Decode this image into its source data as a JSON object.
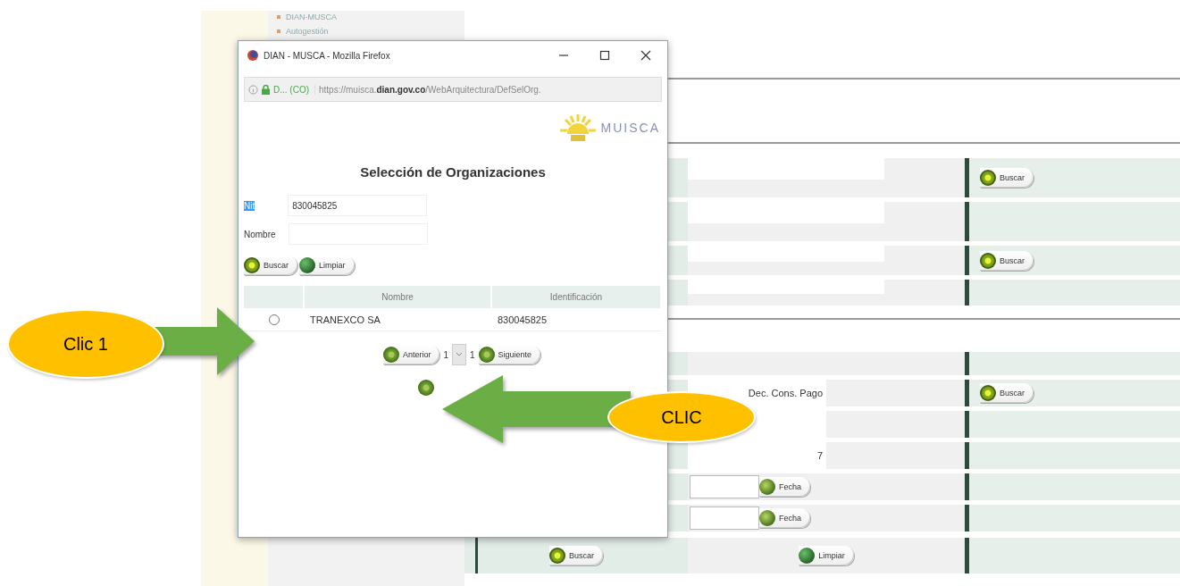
{
  "sidebar": {
    "items": [
      {
        "label": "DIAN-MUSCA"
      },
      {
        "label": "Autogestión"
      }
    ]
  },
  "form": {
    "sections": [
      {
        "rows": [
          {
            "kind": "input",
            "action": "Buscar"
          },
          {
            "kind": "input"
          },
          {
            "kind": "input",
            "action": "Buscar"
          },
          {
            "kind": "input"
          }
        ]
      },
      {
        "rows": [
          {
            "kind": "plain"
          },
          {
            "kind": "text",
            "text": "Dec. Cons. Pago",
            "action": "Buscar"
          },
          {
            "kind": "blank"
          },
          {
            "kind": "text",
            "text": "7"
          },
          {
            "kind": "date",
            "button": "Fecha"
          },
          {
            "kind": "date",
            "button": "Fecha"
          }
        ],
        "footer": [
          {
            "label": "Buscar"
          },
          {
            "label": "Limpiar"
          }
        ]
      }
    ]
  },
  "popup": {
    "title": "DIAN - MUSCA - Mozilla Firefox",
    "site": "D... (CO)",
    "url": "https://muisca.**dian.gov.co**/WebArquitectura/DefSelOrg.",
    "logo": "MUISCA",
    "heading": "Selección de Organizaciones",
    "fields": [
      {
        "label": "Nit",
        "value": "830045825",
        "highlighted": true
      },
      {
        "label": "Nombre",
        "highlighted": false
      }
    ],
    "buttons": [
      {
        "label": "Buscar"
      },
      {
        "label": "Limpiar"
      }
    ],
    "table": {
      "columns": [
        "Nombre",
        "Identificación"
      ],
      "rows": [
        {
          "name": "TRANEXCO SA",
          "id": "830045825",
          "selected": false
        }
      ]
    },
    "pager": {
      "previous": "Anterior",
      "page": "1",
      "total": "1",
      "next": "Siguiente"
    }
  },
  "annotations": [
    {
      "label": "Clic 1"
    },
    {
      "label": "CLIC"
    }
  ]
}
